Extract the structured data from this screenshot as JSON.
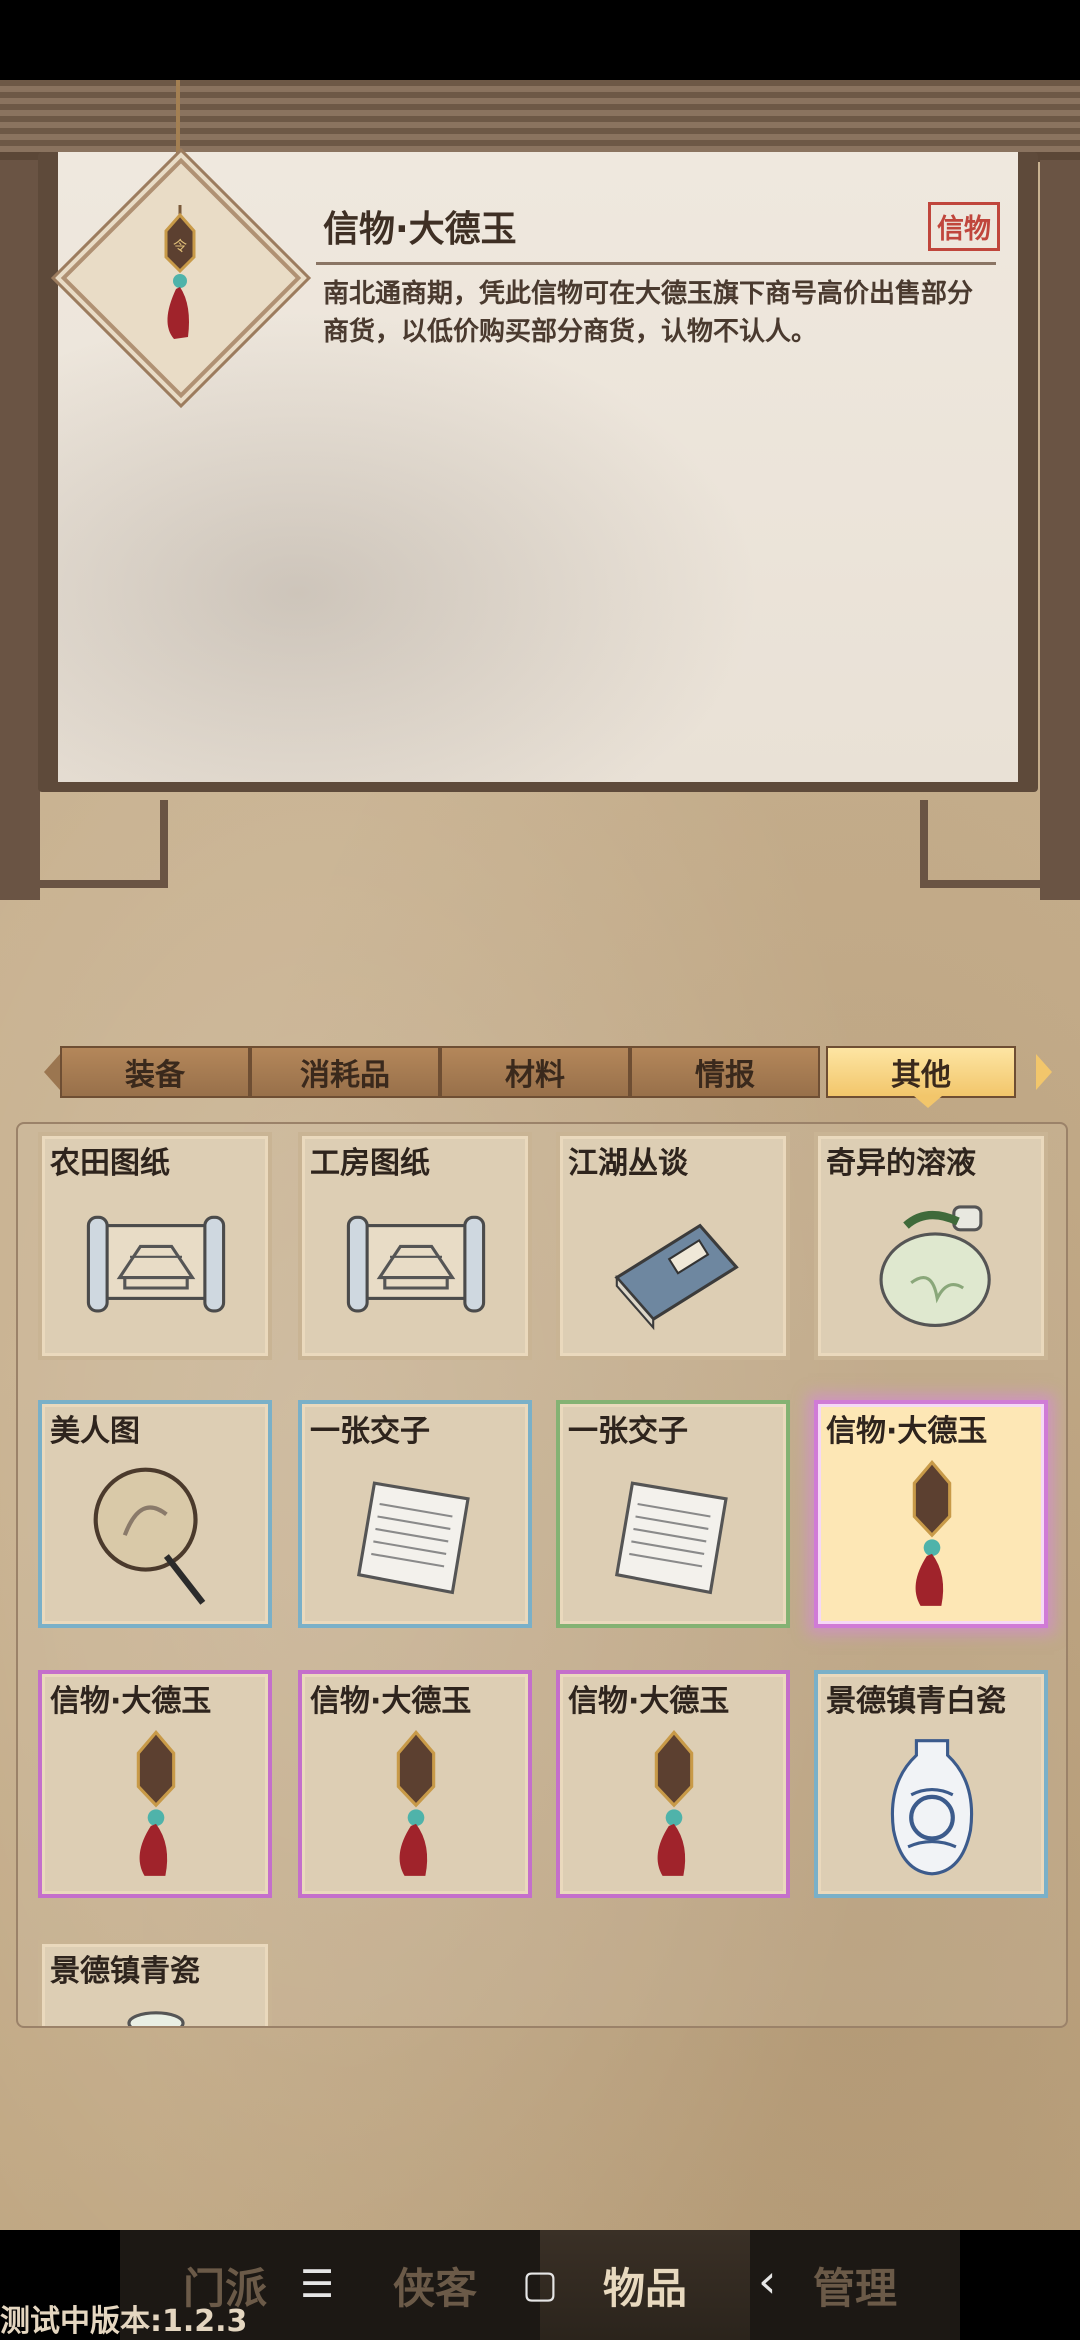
{
  "detail": {
    "title": "信物·大德玉",
    "type_badge": "信物",
    "description": "南北通商期，凭此信物可在大德玉旗下商号高价出售部分商货，以低价购买部分商货，认物不认人。",
    "icon": "jade-pendant-icon"
  },
  "tabs": [
    {
      "label": "装备",
      "active": false
    },
    {
      "label": "消耗品",
      "active": false
    },
    {
      "label": "材料",
      "active": false
    },
    {
      "label": "情报",
      "active": false
    },
    {
      "label": "其他",
      "active": true
    }
  ],
  "items": [
    {
      "name": "农田图纸",
      "rarity": "common",
      "icon": "scroll-blueprint-icon"
    },
    {
      "name": "工房图纸",
      "rarity": "common",
      "icon": "scroll-blueprint-icon"
    },
    {
      "name": "江湖丛谈",
      "rarity": "common",
      "icon": "book-icon"
    },
    {
      "name": "奇异的溶液",
      "rarity": "common",
      "icon": "flask-icon"
    },
    {
      "name": "美人图",
      "rarity": "blue",
      "icon": "fan-icon"
    },
    {
      "name": "一张交子",
      "rarity": "blue",
      "icon": "paper-note-icon"
    },
    {
      "name": "一张交子",
      "rarity": "green",
      "icon": "paper-note-icon"
    },
    {
      "name": "信物·大德玉",
      "rarity": "purple",
      "icon": "jade-pendant-icon",
      "selected": true
    },
    {
      "name": "信物·大德玉",
      "rarity": "purple",
      "icon": "jade-pendant-icon"
    },
    {
      "name": "信物·大德玉",
      "rarity": "purple",
      "icon": "jade-pendant-icon"
    },
    {
      "name": "信物·大德玉",
      "rarity": "purple",
      "icon": "jade-pendant-icon"
    },
    {
      "name": "景德镇青白瓷",
      "rarity": "blue",
      "icon": "porcelain-vase-icon"
    },
    {
      "name": "景德镇青瓷",
      "rarity": "common",
      "icon": "porcelain-bowl-icon"
    }
  ],
  "nav": [
    {
      "label": "门派",
      "active": false
    },
    {
      "label": "侠客",
      "active": false
    },
    {
      "label": "物品",
      "active": true
    },
    {
      "label": "管理",
      "active": false
    }
  ],
  "system_nav": {
    "menu": "☰",
    "home": "▢",
    "back": "‹"
  },
  "version_text": "测试中版本:1.2.3",
  "colors": {
    "rarity_blue": "#7ab0c8",
    "rarity_green": "#84b273",
    "rarity_purple": "#c46fcb",
    "badge_red": "#c0463c"
  }
}
